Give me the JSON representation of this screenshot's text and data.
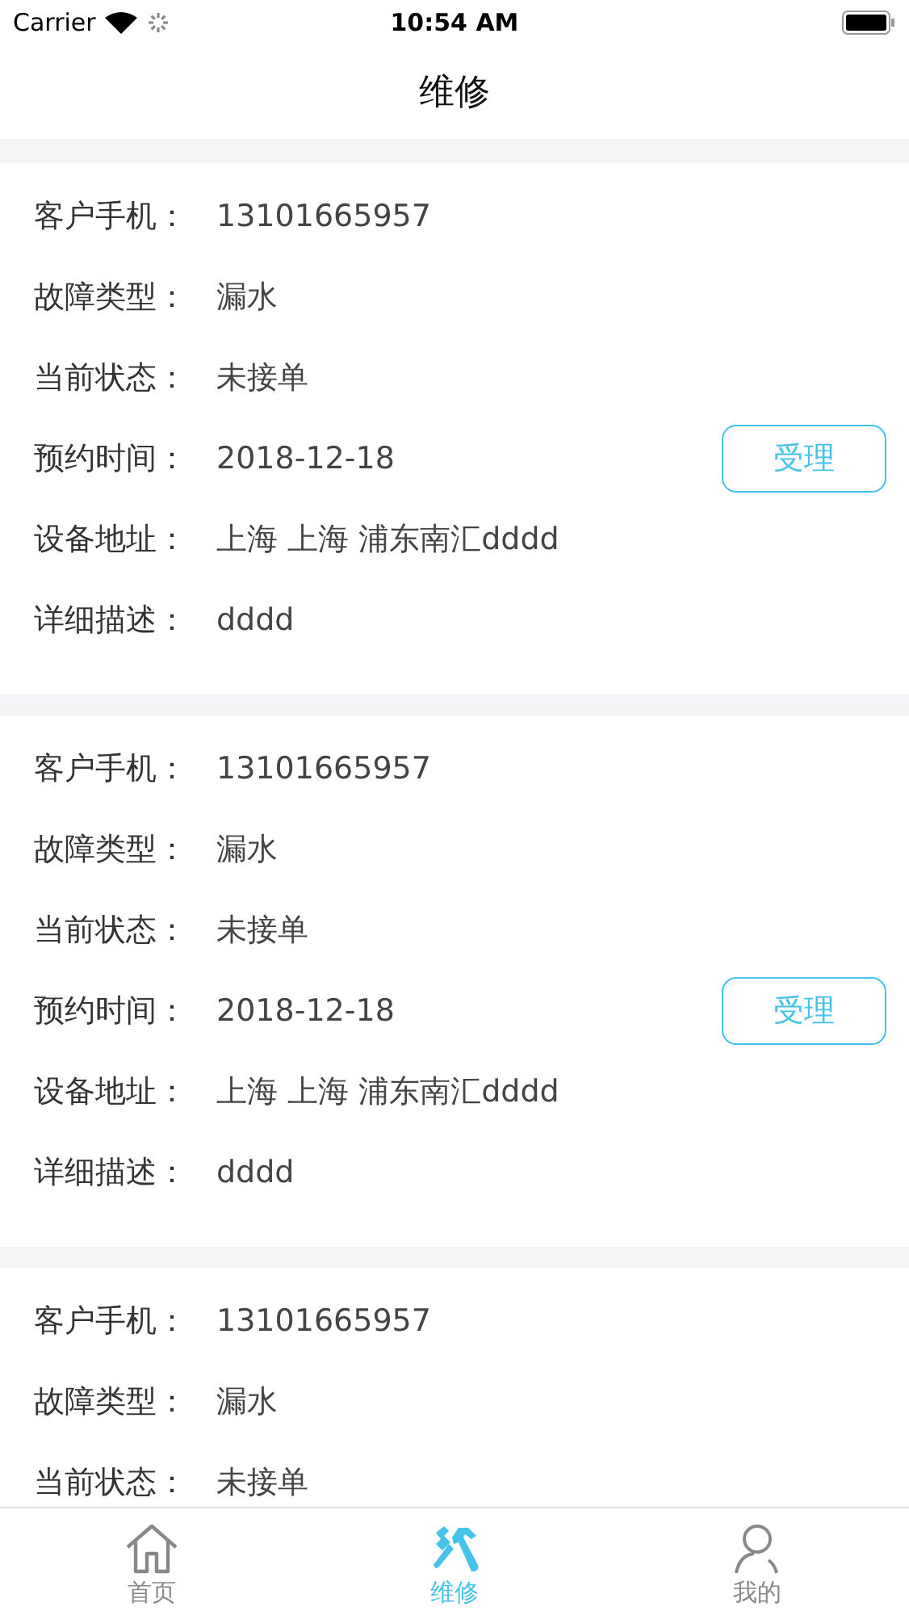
{
  "status_bar": {
    "carrier": "Carrier",
    "time": "10:54 AM"
  },
  "nav": {
    "title": "维修"
  },
  "orders": [
    {
      "fields": [
        {
          "label": "客户手机：",
          "value": "13101665957"
        },
        {
          "label": "故障类型：",
          "value": "漏水"
        },
        {
          "label": "当前状态：",
          "value": "未接单"
        },
        {
          "label": "预约时间：",
          "value": "2018-12-18",
          "action": "受理"
        },
        {
          "label": "设备地址：",
          "value": "上海 上海 浦东南汇dddd"
        },
        {
          "label": "详细描述：",
          "value": "dddd"
        }
      ]
    },
    {
      "fields": [
        {
          "label": "客户手机：",
          "value": "13101665957"
        },
        {
          "label": "故障类型：",
          "value": "漏水"
        },
        {
          "label": "当前状态：",
          "value": "未接单"
        },
        {
          "label": "预约时间：",
          "value": "2018-12-18",
          "action": "受理"
        },
        {
          "label": "设备地址：",
          "value": "上海 上海 浦东南汇dddd"
        },
        {
          "label": "详细描述：",
          "value": "dddd"
        }
      ]
    },
    {
      "fields": [
        {
          "label": "客户手机：",
          "value": "13101665957"
        },
        {
          "label": "故障类型：",
          "value": "漏水"
        },
        {
          "label": "当前状态：",
          "value": "未接单"
        }
      ]
    }
  ],
  "tabs": [
    {
      "kind": "home",
      "label": "首页",
      "selected": false
    },
    {
      "kind": "tools",
      "label": "维修",
      "selected": true
    },
    {
      "kind": "person",
      "label": "我的",
      "selected": false
    }
  ]
}
